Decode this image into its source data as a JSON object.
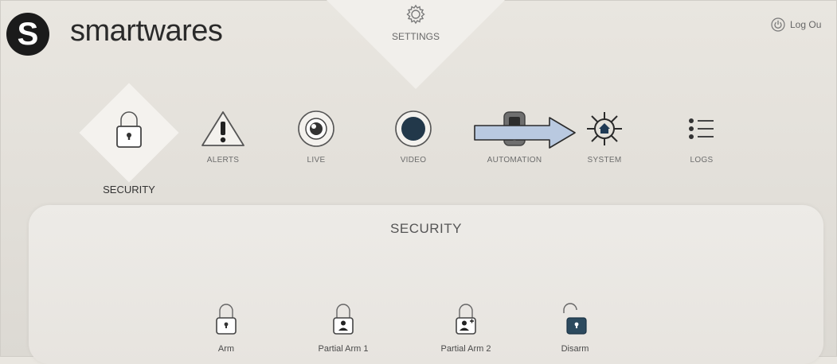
{
  "brand": {
    "logo_letter": "S",
    "name": "smartwares"
  },
  "header": {
    "settings_label": "SETTINGS",
    "logout_label": "Log Ou"
  },
  "nav": {
    "items": [
      {
        "key": "security",
        "label": "SECURITY",
        "icon": "lock-icon"
      },
      {
        "key": "alerts",
        "label": "ALERTS",
        "icon": "warning-icon"
      },
      {
        "key": "live",
        "label": "LIVE",
        "icon": "eye-icon"
      },
      {
        "key": "video",
        "label": "VIDEO",
        "icon": "record-icon"
      },
      {
        "key": "automation",
        "label": "AUTOMATION",
        "icon": "automation-icon"
      },
      {
        "key": "system",
        "label": "SYSTEM",
        "icon": "network-home-icon"
      },
      {
        "key": "logs",
        "label": "LOGS",
        "icon": "list-icon"
      }
    ],
    "active": "security"
  },
  "panel": {
    "title": "SECURITY",
    "modes": [
      {
        "label": "Arm",
        "icon": "lock-icon"
      },
      {
        "label": "Partial Arm 1",
        "icon": "person-lock-icon"
      },
      {
        "label": "Partial Arm 2",
        "icon": "person-plus-lock-icon"
      },
      {
        "label": "Disarm",
        "icon": "unlock-icon"
      }
    ]
  },
  "colors": {
    "accent": "#2c4a5e",
    "annotation_arrow": "#b9c9e0"
  }
}
